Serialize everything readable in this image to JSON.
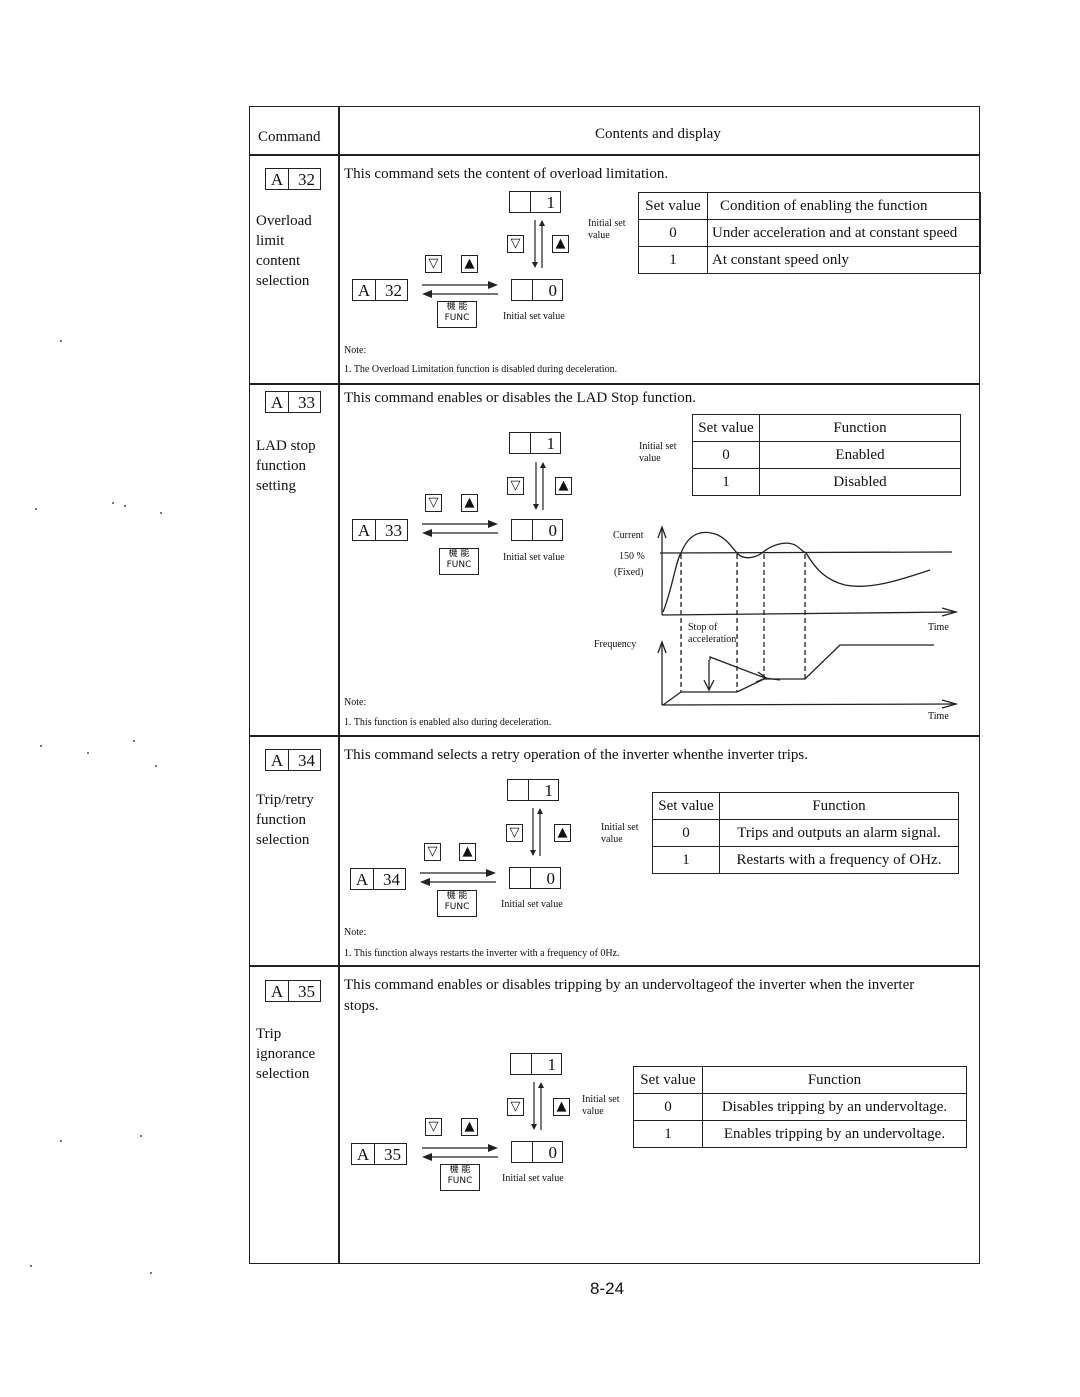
{
  "header": {
    "command_label": "Command",
    "contents_label": "Contents and display"
  },
  "common": {
    "initial_set": "Initial set",
    "value": "value",
    "initial_set_value": "Initial set value",
    "func_kanji": "機 能",
    "func_label": "FUNC",
    "down_key": "▽",
    "up_key": "▲",
    "note_label": "Note:",
    "set_value_header": "Set value",
    "display_letter": "A",
    "value_top": "1",
    "value_bottom": "0"
  },
  "commands": [
    {
      "code": "32",
      "title": "Overload limit content selection",
      "title_lines": [
        "Overload",
        "limit",
        "content",
        "selection"
      ],
      "description": "This command sets the content of overload limitation.",
      "table_header": "Condition of enabling the function",
      "rows": [
        {
          "value": "0",
          "text": "Under acceleration and at constant speed"
        },
        {
          "value": "1",
          "text": "At constant speed only"
        }
      ],
      "note": "1. The Overload Limitation function is disabled during deceleration."
    },
    {
      "code": "33",
      "title": "LAD stop function setting",
      "title_lines": [
        "LAD stop",
        "function",
        "setting"
      ],
      "description": "This command enables or disables the LAD Stop function.",
      "table_header": "Function",
      "rows": [
        {
          "value": "0",
          "text": "Enabled"
        },
        {
          "value": "1",
          "text": "Disabled"
        }
      ],
      "graph": {
        "current_label": "Current",
        "level_label": "150 %",
        "fixed_label": "(Fixed)",
        "time_label": "Time",
        "frequency_label": "Frequency",
        "stop_label_1": "Stop of",
        "stop_label_2": "acceleration"
      },
      "note": "1. This function is enabled also during deceleration."
    },
    {
      "code": "34",
      "title": "Trip/retry function selection",
      "title_lines": [
        "Trip/retry",
        "function",
        "selection"
      ],
      "description": "This command selects a retry operation of the inverter whenthe inverter trips.",
      "table_header": "Function",
      "rows": [
        {
          "value": "0",
          "text": "Trips and outputs an alarm signal."
        },
        {
          "value": "1",
          "text": "Restarts with a frequency of OHz."
        }
      ],
      "note": "1. This function always restarts the inverter with a frequency of 0Hz."
    },
    {
      "code": "35",
      "title": "Trip ignorance selection",
      "title_lines": [
        "Trip",
        "ignorance",
        "selection"
      ],
      "description_lines": [
        "This command enables or disables tripping by an undervoltageof the inverter when the inverter",
        "stops."
      ],
      "table_header": "Function",
      "rows": [
        {
          "value": "0",
          "text": "Disables tripping by an undervoltage."
        },
        {
          "value": "1",
          "text": "Enables tripping by an undervoltage."
        }
      ]
    }
  ],
  "page_number": "8-24"
}
